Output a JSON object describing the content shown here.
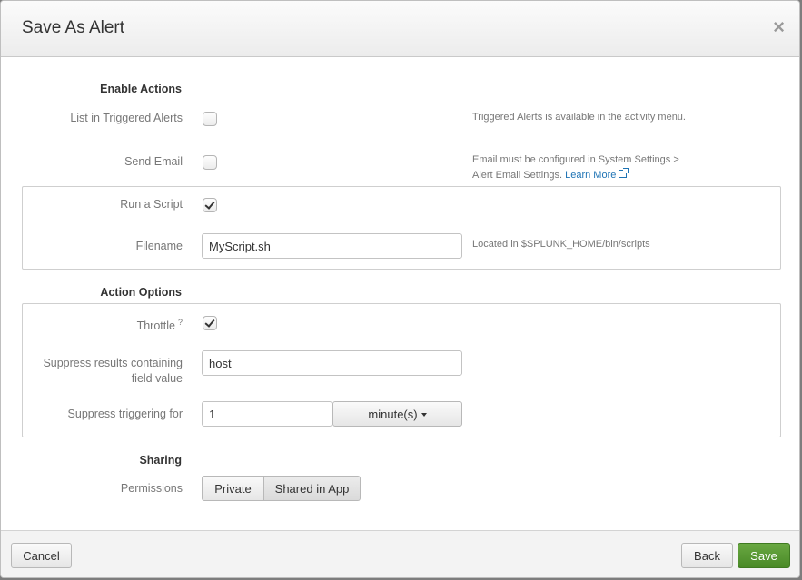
{
  "header": {
    "title": "Save As Alert",
    "close": "×"
  },
  "enable_actions": {
    "title": "Enable Actions",
    "list_triggered": {
      "label": "List in Triggered Alerts",
      "checked": false,
      "help": "Triggered Alerts is available in the activity menu."
    },
    "send_email": {
      "label": "Send Email",
      "checked": false,
      "help_line1": "Email must be configured in System Settings >",
      "help_line2": "Alert Email Settings.",
      "learn_more": "Learn More"
    },
    "run_script": {
      "label": "Run a Script",
      "checked": true
    },
    "filename": {
      "label": "Filename",
      "value": "MyScript.sh",
      "help": "Located in $SPLUNK_HOME/bin/scripts"
    }
  },
  "action_options": {
    "title": "Action Options",
    "throttle": {
      "label": "Throttle",
      "help_mark": "?",
      "checked": true
    },
    "suppress_field": {
      "label_line1": "Suppress results containing",
      "label_line2": "field value",
      "value": "host"
    },
    "suppress_for": {
      "label": "Suppress triggering for",
      "value": "1",
      "unit": "minute(s)"
    }
  },
  "sharing": {
    "title": "Sharing",
    "permissions": {
      "label": "Permissions",
      "options": [
        "Private",
        "Shared in App"
      ],
      "selected": "Shared in App"
    }
  },
  "footer": {
    "cancel": "Cancel",
    "back": "Back",
    "save": "Save"
  },
  "colors": {
    "primary": "#5a9a33",
    "link": "#1e73b4"
  }
}
